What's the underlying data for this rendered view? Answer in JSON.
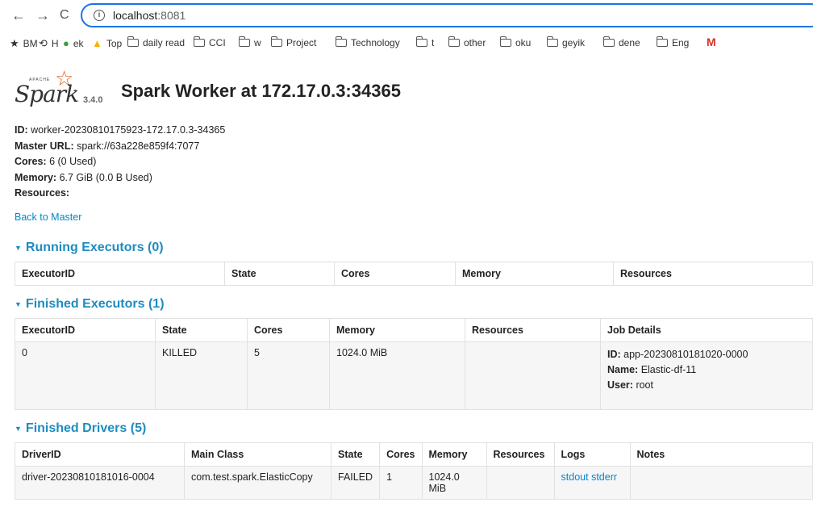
{
  "browser": {
    "nav": {
      "back": "←",
      "forward": "→",
      "reload": "C"
    },
    "url_host": "localhost",
    "url_port": ":8081",
    "bookmarks": [
      {
        "icon": "star-icon",
        "label": "BM"
      },
      {
        "icon": "history-icon",
        "label": "H"
      },
      {
        "icon": "drop-icon",
        "label": "ek"
      },
      {
        "icon": "drive-icon",
        "label": "Top"
      },
      {
        "icon": "folder-icon",
        "label": "daily read"
      },
      {
        "icon": "folder-icon",
        "label": "CCI"
      },
      {
        "icon": "folder-icon",
        "label": "w"
      },
      {
        "icon": "folder-icon",
        "label": "Project"
      },
      {
        "icon": "folder-icon",
        "label": "Technology"
      },
      {
        "icon": "folder-icon",
        "label": "t"
      },
      {
        "icon": "folder-icon",
        "label": "other"
      },
      {
        "icon": "folder-icon",
        "label": "oku"
      },
      {
        "icon": "folder-icon",
        "label": "geyik"
      },
      {
        "icon": "folder-icon",
        "label": "dene"
      },
      {
        "icon": "folder-icon",
        "label": "Eng"
      },
      {
        "icon": "gmail-icon",
        "label": "M"
      }
    ]
  },
  "logo": {
    "apache": "APACHE",
    "spark": "Spark",
    "version": "3.4.0"
  },
  "title": "Spark Worker at 172.17.0.3:34365",
  "props": {
    "id_label": "ID:",
    "id_value": " worker-20230810175923-172.17.0.3-34365",
    "master_label": "Master URL:",
    "master_value": " spark://63a228e859f4:7077",
    "cores_label": "Cores:",
    "cores_value": " 6 (0 Used)",
    "memory_label": "Memory:",
    "memory_value": " 6.7 GiB (0.0 B Used)",
    "resources_label": "Resources:"
  },
  "back_link": "Back to Master",
  "running": {
    "title": "Running Executors (0)",
    "headers": [
      "ExecutorID",
      "State",
      "Cores",
      "Memory",
      "Resources"
    ]
  },
  "finished_exec": {
    "title": "Finished Executors (1)",
    "headers": [
      "ExecutorID",
      "State",
      "Cores",
      "Memory",
      "Resources",
      "Job Details"
    ],
    "row": {
      "id": "0",
      "state": "KILLED",
      "cores": "5",
      "memory": "1024.0 MiB",
      "resources": "",
      "job_id_label": "ID:",
      "job_id": " app-20230810181020-0000",
      "job_name_label": "Name:",
      "job_name": " Elastic-df-11",
      "job_user_label": "User:",
      "job_user": " root"
    }
  },
  "finished_drivers": {
    "title": "Finished Drivers (5)",
    "headers": [
      "DriverID",
      "Main Class",
      "State",
      "Cores",
      "Memory",
      "Resources",
      "Logs",
      "Notes"
    ],
    "row": {
      "id": "driver-20230810181016-0004",
      "main_class": "com.test.spark.ElasticCopy",
      "state": "FAILED",
      "cores": "1",
      "memory": "1024.0 MiB",
      "resources": "",
      "stdout": "stdout",
      "stderr": "stderr",
      "notes": ""
    }
  },
  "colors": {
    "link": "#0088cc",
    "section": "#1f8cc0",
    "spark_orange": "#e25a1c",
    "url_border": "#1a73e8"
  }
}
